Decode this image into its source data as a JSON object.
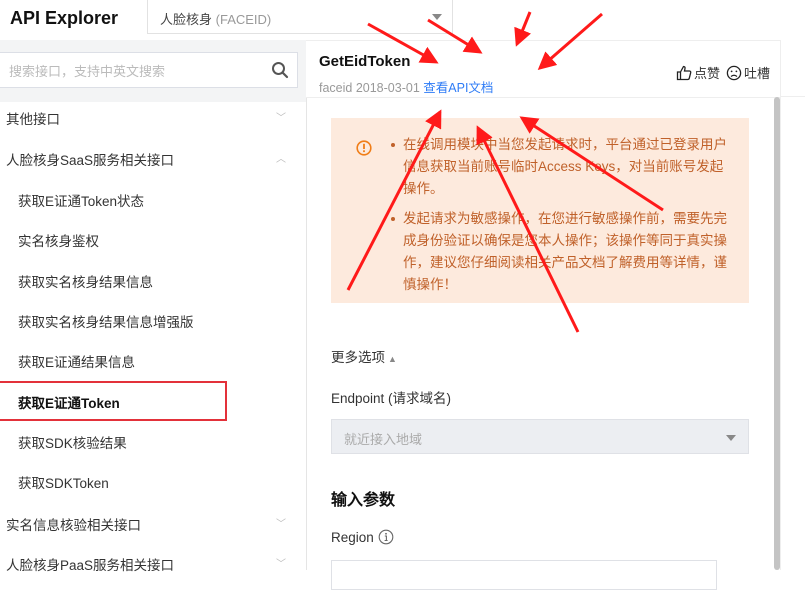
{
  "header": {
    "app_title": "API Explorer",
    "product_select": {
      "label": "人脸核身",
      "code": "(FACEID)"
    }
  },
  "sidebar": {
    "search_placeholder": "搜索接口，支持中英文搜索",
    "items": [
      {
        "label": "其他接口",
        "type": "group",
        "expanded": false
      },
      {
        "label": "人脸核身SaaS服务相关接口",
        "type": "group",
        "expanded": true
      },
      {
        "label": "获取E证通Token状态",
        "type": "sub"
      },
      {
        "label": "实名核身鉴权",
        "type": "sub"
      },
      {
        "label": "获取实名核身结果信息",
        "type": "sub"
      },
      {
        "label": "获取实名核身结果信息增强版",
        "type": "sub"
      },
      {
        "label": "获取E证通结果信息",
        "type": "sub"
      },
      {
        "label": "获取E证通Token",
        "type": "sub",
        "active": true
      },
      {
        "label": "获取SDK核验结果",
        "type": "sub"
      },
      {
        "label": "获取SDKToken",
        "type": "sub"
      },
      {
        "label": "实名信息核验相关接口",
        "type": "group",
        "expanded": false
      },
      {
        "label": "人脸核身PaaS服务相关接口",
        "type": "group",
        "expanded": false
      }
    ]
  },
  "main": {
    "api_name": "GetEidToken",
    "api_meta": "faceid 2018-03-01",
    "doc_link": "查看API文档",
    "like_label": "点赞",
    "complain_label": "吐槽",
    "notice": [
      "在线调用模块中当您发起请求时，平台通过已登录用户信息获取当前账号临时Access Keys，对当前账号发起操作。",
      "发起请求为敏感操作，在您进行敏感操作前，需要先完成身份验证以确保是您本人操作；该操作等同于真实操作，建议您仔细阅读相关产品文档了解费用等详情，谨慎操作！"
    ],
    "more_options": "更多选项",
    "endpoint_label": "Endpoint (请求域名)",
    "endpoint_value": "就近接入地域",
    "input_params_title": "输入参数",
    "region_label": "Region"
  },
  "colors": {
    "link": "#2f7cf6",
    "notice_bg": "#fdeadd",
    "notice_text": "#c0612a",
    "warning_icon": "#f07d17",
    "active_outline": "#e3313a",
    "annotation_arrow": "#ff1a1a"
  }
}
